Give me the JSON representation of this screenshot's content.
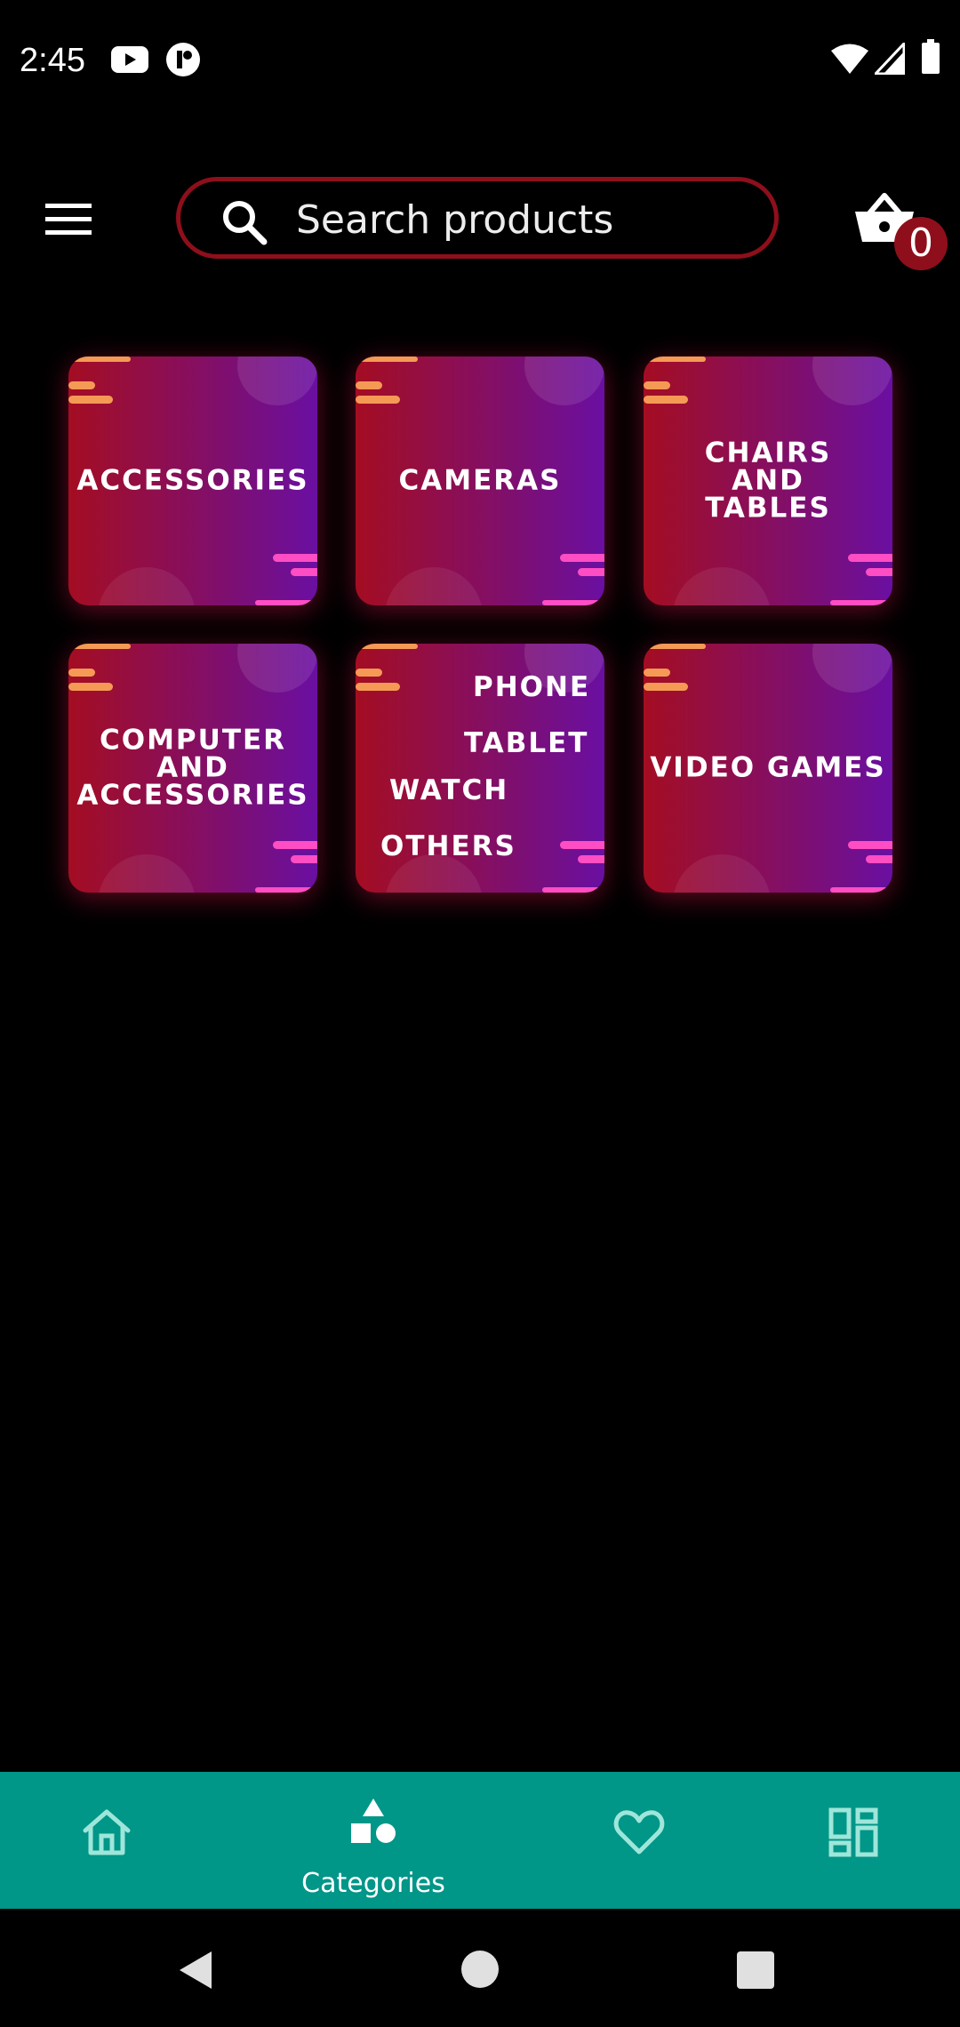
{
  "status_bar": {
    "time": "2:45",
    "notification_icons": [
      "youtube-icon",
      "app-notification-icon"
    ],
    "system_icons": [
      "wifi-icon",
      "cellular-signal-icon",
      "battery-icon"
    ]
  },
  "app_bar": {
    "menu_icon": "hamburger-menu-icon",
    "search": {
      "placeholder": "Search products",
      "value": ""
    },
    "cart": {
      "icon": "shopping-basket-icon",
      "count": "0"
    }
  },
  "categories": [
    {
      "label_lines": [
        "Accessories"
      ]
    },
    {
      "label_lines": [
        "Cameras"
      ]
    },
    {
      "label_lines": [
        "Chairs",
        "and",
        "Tables"
      ]
    },
    {
      "label_lines": [
        "Computer",
        "and",
        "Accessories"
      ]
    },
    {
      "label_lines": [
        "Phone",
        "Tablet",
        "Watch",
        "Others"
      ]
    },
    {
      "label_lines": [
        "Video Games"
      ]
    }
  ],
  "bottom_nav": {
    "items": [
      {
        "icon": "home-icon",
        "label": ""
      },
      {
        "icon": "categories-shapes-icon",
        "label": "Categories",
        "active": true
      },
      {
        "icon": "heart-icon",
        "label": ""
      },
      {
        "icon": "dashboard-icon",
        "label": ""
      }
    ]
  },
  "system_nav": {
    "buttons": [
      "back-triangle-icon",
      "home-circle-icon",
      "recents-square-icon"
    ]
  },
  "colors": {
    "accent": "#8e0f1b",
    "nav_background": "#009688",
    "tile_gradient_start": "#a40d22",
    "tile_gradient_end": "#6a0fa2",
    "tile_stripe_orange": "#f59a55",
    "tile_stripe_pink": "#ff4dc4"
  }
}
